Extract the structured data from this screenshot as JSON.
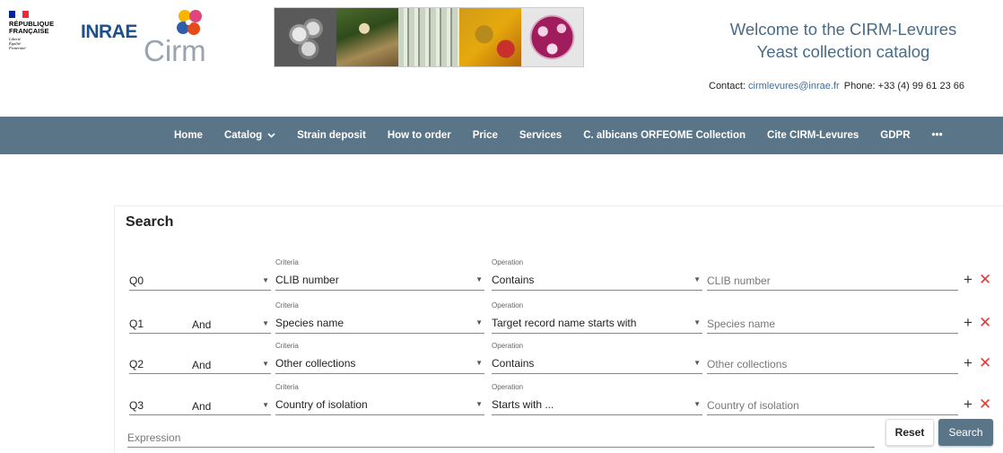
{
  "header": {
    "republique": {
      "lines": [
        "RÉPUBLIQUE",
        "FRANÇAISE"
      ],
      "motto": [
        "Liberté",
        "Égalité",
        "Fraternité"
      ]
    },
    "inrae_logo": "INRAE",
    "cirm_logo": "Cirm",
    "welcome_line1": "Welcome to the CIRM-Levures",
    "welcome_line2": "Yeast collection catalog",
    "contact_label": "Contact:",
    "contact_email": "cirmlevures@inrae.fr",
    "phone_label": "Phone:",
    "phone": "+33 (4) 99 61 23 66"
  },
  "nav": {
    "items": [
      {
        "label": "Home"
      },
      {
        "label": "Catalog",
        "dropdown": true
      },
      {
        "label": "Strain deposit"
      },
      {
        "label": "How to order"
      },
      {
        "label": "Price"
      },
      {
        "label": "Services"
      },
      {
        "label": "C. albicans ORFEOME Collection"
      },
      {
        "label": "Cite CIRM-Levures"
      },
      {
        "label": "GDPR"
      },
      {
        "label": "•••"
      }
    ]
  },
  "search": {
    "title": "Search",
    "criteria_label": "Criteria",
    "operation_label": "Operation",
    "rows": [
      {
        "q": "Q0",
        "logic": "",
        "criteria": "CLIB number",
        "operation": "Contains",
        "placeholder": "CLIB number"
      },
      {
        "q": "Q1",
        "logic": "And",
        "criteria": "Species name",
        "operation": "Target record name starts with",
        "placeholder": "Species name"
      },
      {
        "q": "Q2",
        "logic": "And",
        "criteria": "Other collections",
        "operation": "Contains",
        "placeholder": "Other collections"
      },
      {
        "q": "Q3",
        "logic": "And",
        "criteria": "Country of isolation",
        "operation": "Starts with ...",
        "placeholder": "Country of isolation"
      }
    ],
    "add_symbol": "+",
    "remove_symbol": "✕",
    "expression_placeholder": "Expression",
    "reset_label": "Reset",
    "search_label": "Search"
  },
  "colors": {
    "navbar": "#5b7588",
    "welcome_text": "#4a6b87",
    "remove": "#e53935"
  },
  "icons": [
    "dropdown-arrow-icon",
    "chevron-down-icon",
    "plus-icon",
    "close-icon"
  ]
}
